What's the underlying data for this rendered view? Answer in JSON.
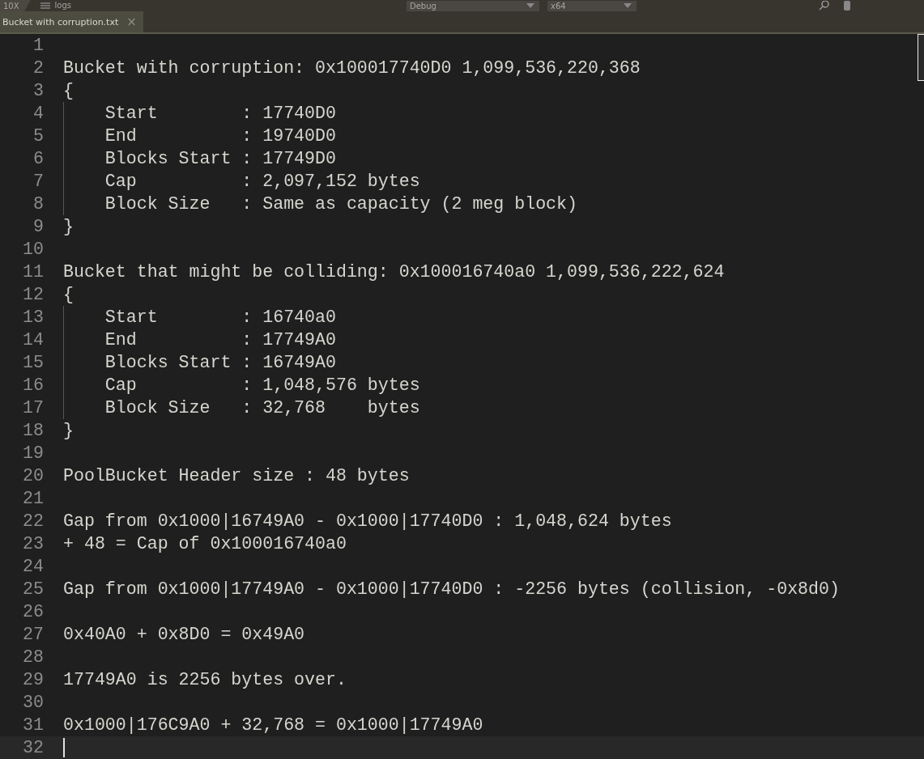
{
  "toolbar": {
    "app": "10X",
    "workspace": "logs",
    "configuration": "Debug",
    "platform": "x64"
  },
  "tab": {
    "title": "Bucket with corruption.txt",
    "close": "×",
    "selected": true
  },
  "lines": [
    {
      "number": "1",
      "current": false
    },
    {
      "number": "2",
      "text": "Bucket with corruption: 0x100017740D0 1,099,536,220,368",
      "current": false
    },
    {
      "number": "3",
      "text": "{",
      "current": false
    },
    {
      "number": "4",
      "text": "    Start        : 17740D0",
      "current": false
    },
    {
      "number": "5",
      "text": "    End          : 19740D0",
      "current": false
    },
    {
      "number": "6",
      "text": "    Blocks Start : 17749D0",
      "current": false
    },
    {
      "number": "7",
      "text": "    Cap          : 2,097,152 bytes",
      "current": false
    },
    {
      "number": "8",
      "text": "    Block Size   : Same as capacity (2 meg block)",
      "current": false
    },
    {
      "number": "9",
      "text": "}",
      "current": false
    },
    {
      "number": "10",
      "current": false
    },
    {
      "number": "11",
      "text": "Bucket that might be colliding: 0x100016740a0 1,099,536,222,624",
      "current": false
    },
    {
      "number": "12",
      "text": "{",
      "current": false
    },
    {
      "number": "13",
      "text": "    Start        : 16740a0",
      "current": false
    },
    {
      "number": "14",
      "text": "    End          : 17749A0",
      "current": false
    },
    {
      "number": "15",
      "text": "    Blocks Start : 16749A0",
      "current": false
    },
    {
      "number": "16",
      "text": "    Cap          : 1,048,576 bytes",
      "current": false
    },
    {
      "number": "17",
      "text": "    Block Size   : 32,768    bytes",
      "current": false
    },
    {
      "number": "18",
      "text": "}",
      "current": false
    },
    {
      "number": "19",
      "current": false
    },
    {
      "number": "20",
      "text": "PoolBucket Header size : 48 bytes",
      "current": false
    },
    {
      "number": "21",
      "current": false
    },
    {
      "number": "22",
      "text": "Gap from 0x1000|16749A0 - 0x1000|17740D0 : 1,048,624 bytes",
      "current": false
    },
    {
      "number": "23",
      "text": "+ 48 = Cap of 0x100016740a0",
      "current": false
    },
    {
      "number": "24",
      "current": false
    },
    {
      "number": "25",
      "text": "Gap from 0x1000|17749A0 - 0x1000|17740D0 : -2256 bytes (collision, -0x8d0)",
      "current": false
    },
    {
      "number": "26",
      "current": false
    },
    {
      "number": "27",
      "text": "0x40A0 + 0x8D0 = 0x49A0",
      "current": false
    },
    {
      "number": "28",
      "current": false
    },
    {
      "number": "29",
      "text": "17749A0 is 2256 bytes over.",
      "current": false
    },
    {
      "number": "30",
      "current": false
    },
    {
      "number": "31",
      "text": "0x1000|176C9A0 + 32,768 = 0x1000|17749A0",
      "current": false
    },
    {
      "number": "32",
      "current": true
    }
  ]
}
